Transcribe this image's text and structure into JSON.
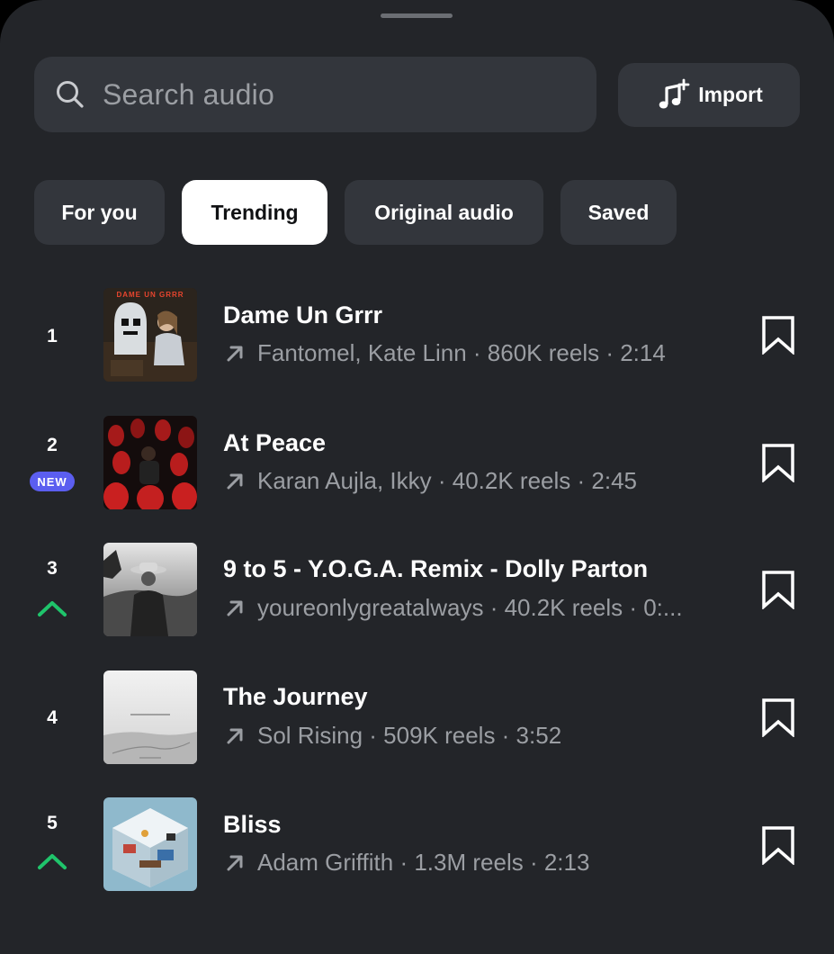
{
  "search": {
    "placeholder": "Search audio"
  },
  "import_button": {
    "label": "Import"
  },
  "tabs": [
    {
      "label": "For you",
      "active": false
    },
    {
      "label": "Trending",
      "active": true
    },
    {
      "label": "Original audio",
      "active": false
    },
    {
      "label": "Saved",
      "active": false
    }
  ],
  "tracks": [
    {
      "rank": "1",
      "title": "Dame Un Grrr",
      "meta": "Fantomel, Kate Linn · 860K reels · 2:14",
      "cover_text": "DAME UN GRRR"
    },
    {
      "rank": "2",
      "badge": "NEW",
      "title": "At Peace",
      "meta": "Karan Aujla, Ikky · 40.2K reels · 2:45"
    },
    {
      "rank": "3",
      "trend": "up",
      "title": "9 to 5 - Y.O.G.A. Remix - Dolly Parton",
      "meta": "youreonlygreatalways · 40.2K reels · 0:..."
    },
    {
      "rank": "4",
      "title": "The Journey",
      "meta": "Sol Rising · 509K reels · 3:52"
    },
    {
      "rank": "5",
      "trend": "up",
      "title": "Bliss",
      "meta": "Adam Griffith · 1.3M reels · 2:13"
    }
  ],
  "colors": {
    "background": "#232529",
    "surface": "#33363c",
    "text_secondary": "#9b9ea3",
    "new_badge": "#5b5ef0",
    "trend_up": "#1fc46b"
  },
  "icons": {
    "search": "search-icon",
    "import": "music-note-plus-icon",
    "source": "arrow-up-right-icon",
    "save": "bookmark-outline-icon",
    "trend": "chevron-up-icon"
  }
}
